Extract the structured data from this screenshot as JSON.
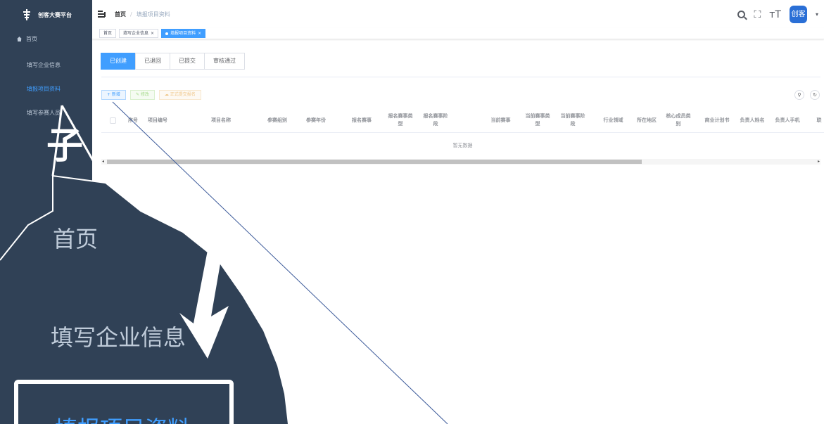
{
  "app": {
    "title": "创客大赛平台",
    "logo_icon": "platform-logo-icon"
  },
  "sidebar": {
    "items": [
      {
        "label": "首页",
        "icon": "home-icon"
      },
      {
        "label": "填写企业信息"
      },
      {
        "label": "填报项目资料",
        "active": true
      },
      {
        "label": "填写参赛人员"
      }
    ]
  },
  "navbar": {
    "breadcrumb": {
      "home": "首页",
      "separator": "/",
      "current": "填报项目资料"
    },
    "icons": [
      "search-icon",
      "fullscreen-icon",
      "font-size-icon"
    ],
    "avatar_text": "创客",
    "avatar_caret": "▾"
  },
  "tags": [
    {
      "label": "首页"
    },
    {
      "label": "填写企业信息",
      "close": "×"
    },
    {
      "label": "填报项目资料",
      "close": "×",
      "active": true
    }
  ],
  "status_tabs": [
    "已创建",
    "已退回",
    "已提交",
    "审核通过"
  ],
  "toolbar": {
    "add": "+ 新增",
    "edit": "✎ 修改",
    "submit": "☁ 正式提交报名"
  },
  "right_tools": [
    "search-icon",
    "refresh-icon"
  ],
  "table": {
    "columns": [
      "序号",
      "项目编号",
      "项目名称",
      "参赛组别",
      "参赛年份",
      "报名赛事",
      "报名赛事类型",
      "报名赛事阶段",
      "当前赛事",
      "当前赛事类型",
      "当前赛事阶段",
      "行业领域",
      "所在地区",
      "核心成员类别",
      "商业计划书",
      "负责人姓名",
      "负责人手机",
      "联"
    ],
    "empty_text": "暂无数据"
  },
  "zoom": {
    "home": "首页",
    "company": "填写企业信息",
    "active": "填报项目资料"
  },
  "colors": {
    "sidebar": "#304156",
    "accent": "#409eff",
    "sidebar_text": "#bfcbd9"
  }
}
